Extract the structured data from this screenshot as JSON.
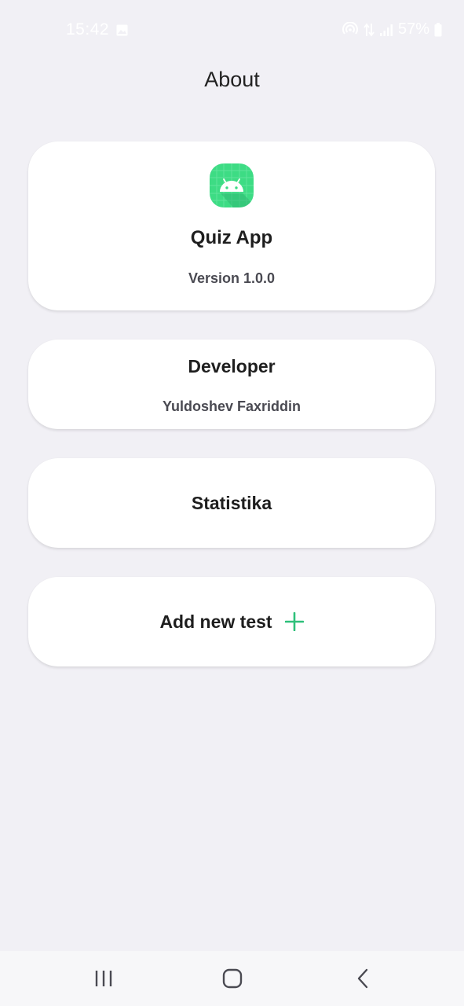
{
  "status_bar": {
    "time": "15:42",
    "battery": "57%",
    "icons": [
      "gallery-icon",
      "hotspot-icon",
      "data-arrows-icon",
      "signal-icon",
      "battery-icon"
    ]
  },
  "header": {
    "title": "About"
  },
  "app_card": {
    "icon": "android-app-icon",
    "name": "Quiz App",
    "version": "Version 1.0.0"
  },
  "developer_card": {
    "title": "Developer",
    "name": "Yuldoshev Faxriddin"
  },
  "statistics_card": {
    "label": "Statistika"
  },
  "add_test_card": {
    "label": "Add new test",
    "icon": "plus-icon"
  },
  "nav_bar": {
    "buttons": [
      "recents-icon",
      "home-icon",
      "back-icon"
    ]
  },
  "colors": {
    "background": "#F1F0F5",
    "card": "#FFFFFF",
    "accent": "#3DDC84",
    "plus": "#2EC07A",
    "title_text": "#1E1E1E",
    "secondary_text": "#4A4A52"
  }
}
